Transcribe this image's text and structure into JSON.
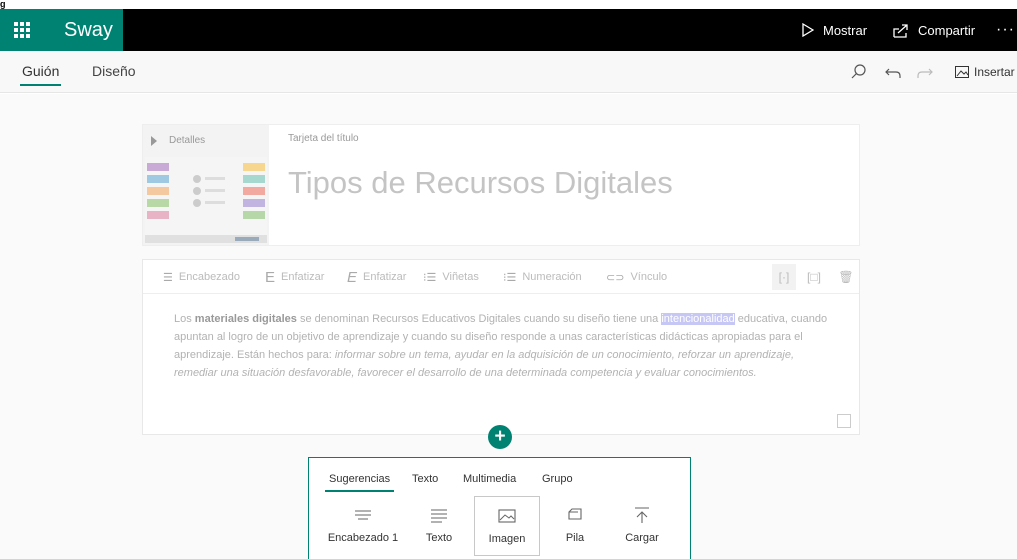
{
  "header": {
    "app_name": "Sway",
    "show_label": "Mostrar",
    "share_label": "Compartir",
    "more_label": "···",
    "accent_color": "#008272"
  },
  "toolbar": {
    "tabs": [
      {
        "label": "Guión",
        "active": true
      },
      {
        "label": "Diseño",
        "active": false
      }
    ],
    "insert_label": "Insertar",
    "icons": [
      "search-icon",
      "undo-icon",
      "redo-icon",
      "image-icon"
    ]
  },
  "title_card": {
    "details_label": "Detalles",
    "card_label": "Tarjeta del título",
    "title": "Tipos de Recursos Digitales"
  },
  "text_card": {
    "format_buttons": [
      "Encabezado",
      "Enfatizar",
      "Enfatizar",
      "Viñetas",
      "Numeración",
      "Vínculo"
    ],
    "paragraph": {
      "bold_term": "materiales digitales",
      "part1_prefix": "Los ",
      "part1_suffix": " se denominan Recursos Educativos Digitales cuando su diseño tiene una ",
      "highlight": "intencionalidad",
      "part2": " educativa, cuando apuntan al logro de un objetivo de aprendizaje y cuando su diseño responde a unas características didácticas apropiadas para el aprendizaje. Están hechos para: ",
      "italic": "informar sobre un tema, ayudar en la adquisición de un conocimiento, reforzar un aprendizaje, remediar una situación desfavorable, favorecer el desarrollo de una determinada competencia y evaluar conocimientos."
    }
  },
  "insert_panel": {
    "tabs": [
      "Sugerencias",
      "Texto",
      "Multimedia",
      "Grupo"
    ],
    "active_tab": "Sugerencias",
    "options": [
      "Encabezado 1",
      "Texto",
      "Imagen",
      "Pila",
      "Cargar"
    ],
    "selected_option": "Imagen"
  }
}
